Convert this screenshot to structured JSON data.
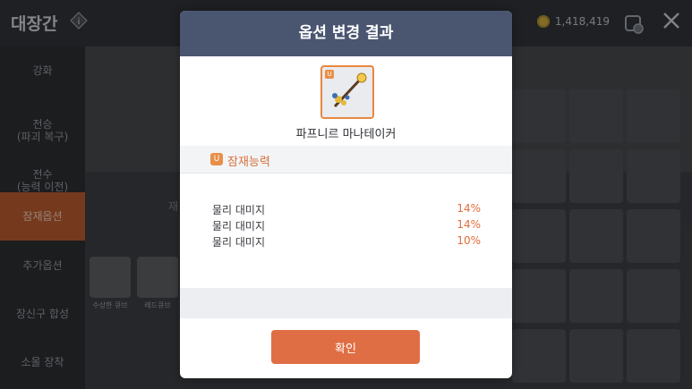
{
  "header": {
    "title": "대장간",
    "currency": "1,418,419"
  },
  "sidebar": {
    "items": [
      {
        "label": "강화"
      },
      {
        "label": "전승\n(파괴 복구)"
      },
      {
        "label": "전수\n(능력 이전)"
      },
      {
        "label": "잠재옵션",
        "active": true
      },
      {
        "label": "추가옵션"
      },
      {
        "label": "장신구 합성"
      },
      {
        "label": "소울 장착"
      }
    ]
  },
  "background": {
    "side_text": "재",
    "cubes": [
      {
        "label": "수상한 큐브"
      },
      {
        "label": "레드큐브"
      }
    ]
  },
  "modal": {
    "title": "옵션 변경 결과",
    "item": {
      "name": "파프니르 마나테이커",
      "grade_badge": "U",
      "icon": "staff-icon"
    },
    "potential": {
      "badge": "U",
      "title": "잠재능력",
      "options": [
        {
          "name": "물리 대미지",
          "value": "14%"
        },
        {
          "name": "물리 대미지",
          "value": "14%"
        },
        {
          "name": "물리 대미지",
          "value": "10%"
        }
      ]
    },
    "confirm_label": "확인"
  },
  "colors": {
    "accent": "#E06E44",
    "header": "#4A5570",
    "option_value": "#E36D3B"
  }
}
